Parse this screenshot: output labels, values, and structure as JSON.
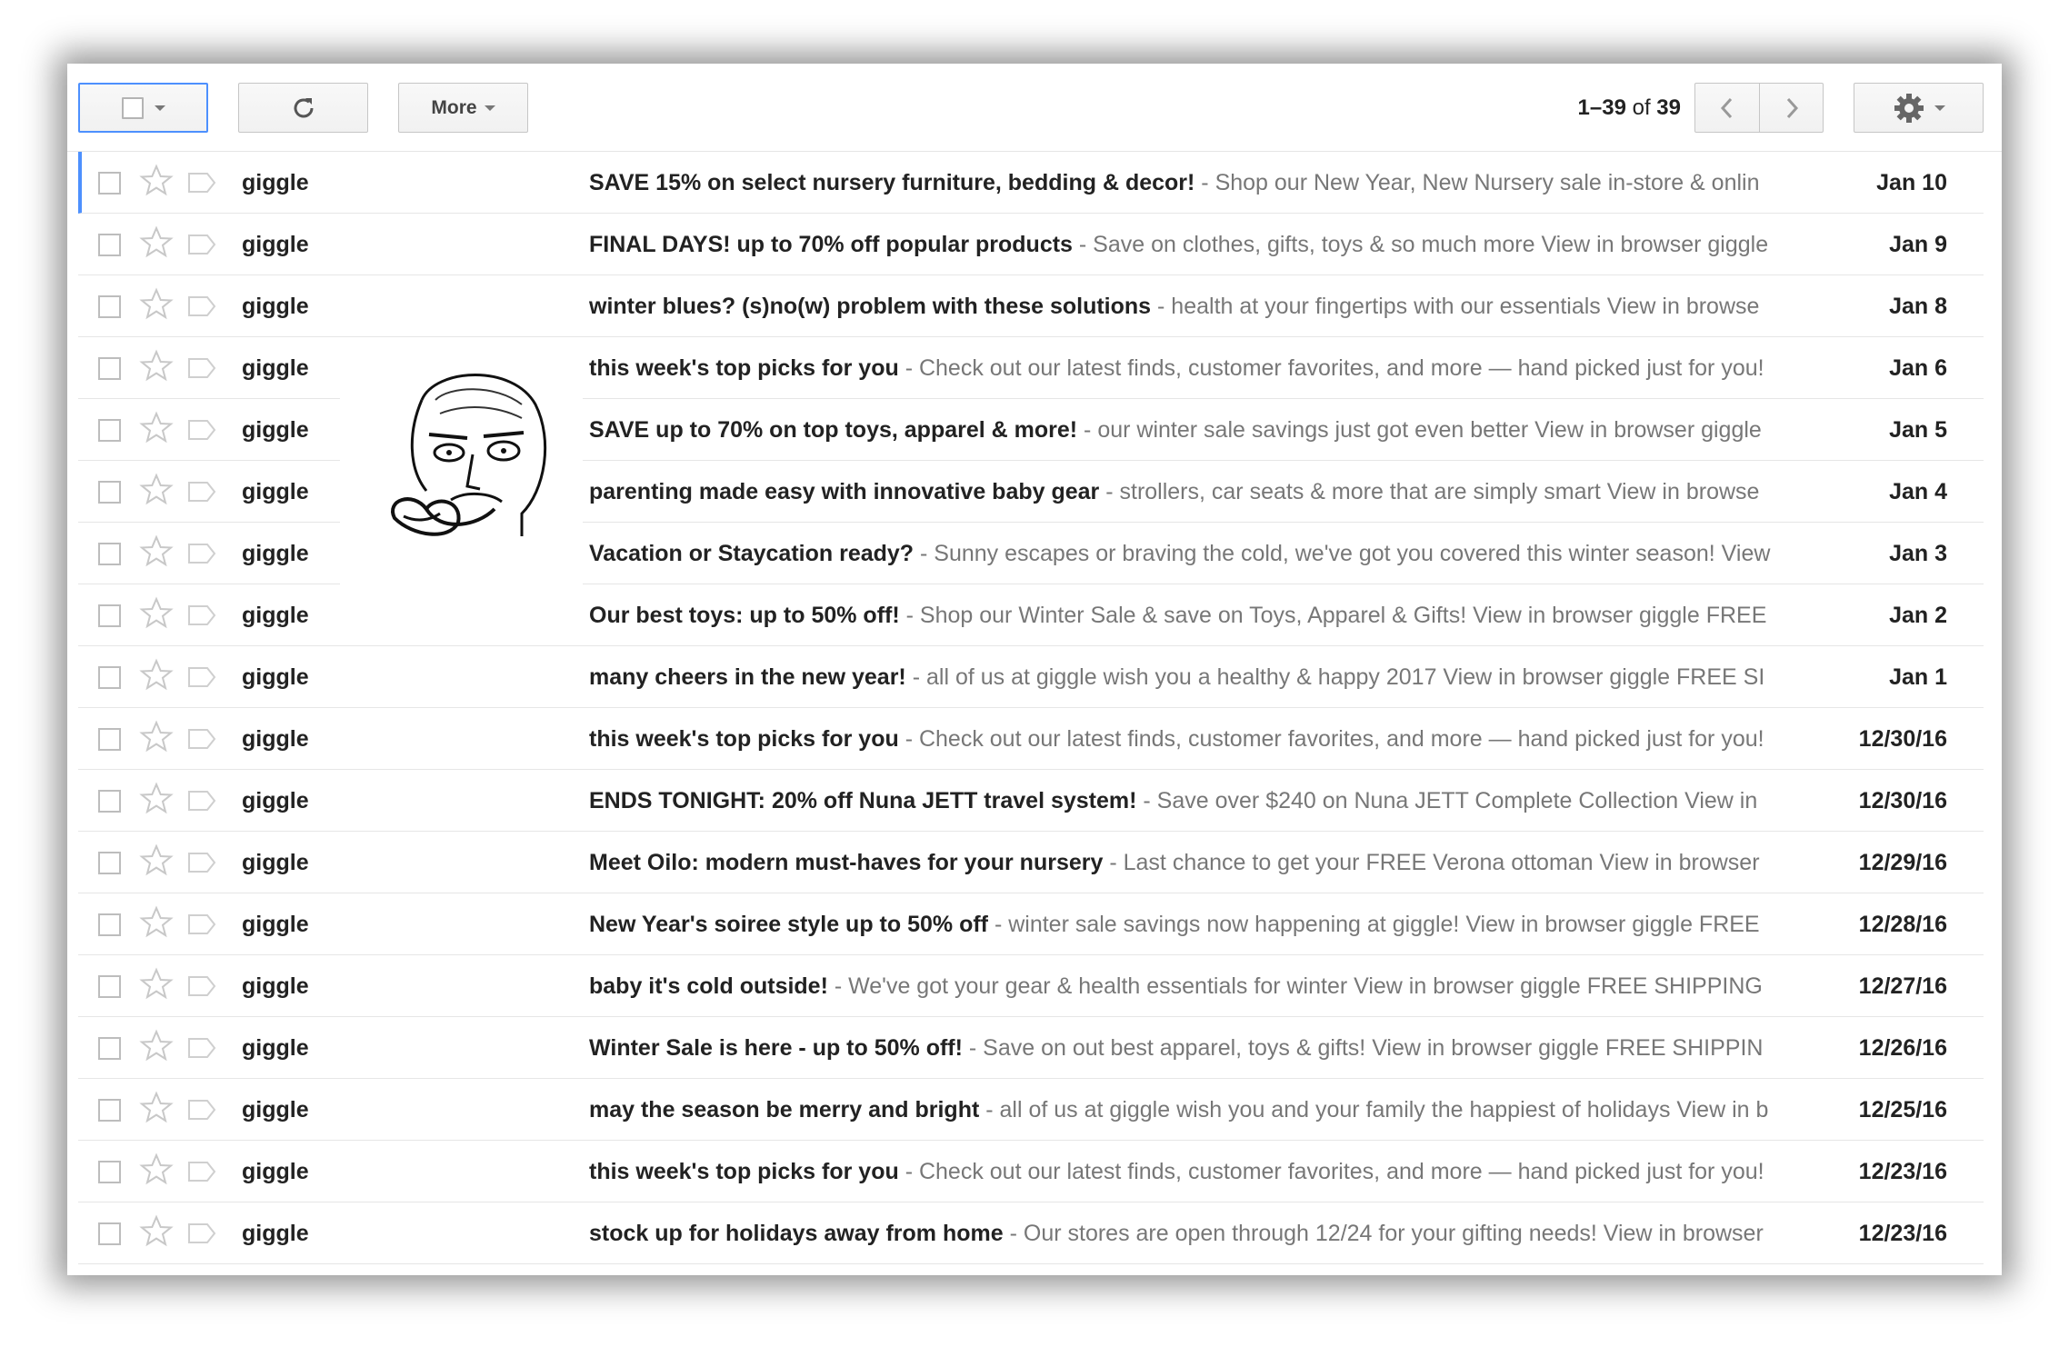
{
  "toolbar": {
    "more_label": "More",
    "pager_range": "1–39",
    "pager_of": "of",
    "pager_total": "39",
    "icons": [
      "checkbox-icon",
      "refresh-icon",
      "chevron-left-icon",
      "chevron-right-icon",
      "gear-icon"
    ]
  },
  "colors": {
    "accent": "#4d90fe",
    "snippet": "#777777",
    "text": "#222222"
  },
  "emails": [
    {
      "sender": "giggle",
      "subject": "SAVE 15% on select nursery furniture, bedding & decor!",
      "snippet": " - Shop our New Year, New Nursery sale in-store & onlin",
      "date": "Jan 10"
    },
    {
      "sender": "giggle",
      "subject": "FINAL DAYS! up to 70% off popular products",
      "snippet": " - Save on clothes, gifts, toys & so much more View in browser giggle",
      "date": "Jan 9"
    },
    {
      "sender": "giggle",
      "subject": "winter blues? (s)no(w) problem with these solutions",
      "snippet": " - health at your fingertips with our essentials View in browse",
      "date": "Jan 8"
    },
    {
      "sender": "giggle",
      "subject": "this week's top picks for you",
      "snippet": " - Check out our latest finds, customer favorites, and more — hand picked just for you!",
      "date": "Jan 6"
    },
    {
      "sender": "giggle",
      "subject": "SAVE up to 70% on top toys, apparel & more!",
      "snippet": " - our winter sale savings just got even better View in browser giggle",
      "date": "Jan 5"
    },
    {
      "sender": "giggle",
      "subject": "parenting made easy with innovative baby gear",
      "snippet": " - strollers, car seats & more that are simply smart View in browse",
      "date": "Jan 4"
    },
    {
      "sender": "giggle",
      "subject": "Vacation or Staycation ready?",
      "snippet": " - Sunny escapes or braving the cold, we've got you covered this winter season! View",
      "date": "Jan 3"
    },
    {
      "sender": "giggle",
      "subject": "Our best toys: up to 50% off!",
      "snippet": " - Shop our Winter Sale & save on Toys, Apparel & Gifts! View in browser giggle FREE",
      "date": "Jan 2"
    },
    {
      "sender": "giggle",
      "subject": "many cheers in the new year!",
      "snippet": " - all of us at giggle wish you a healthy & happy 2017 View in browser giggle FREE SI",
      "date": "Jan 1"
    },
    {
      "sender": "giggle",
      "subject": "this week's top picks for you",
      "snippet": " - Check out our latest finds, customer favorites, and more — hand picked just for you!",
      "date": "12/30/16"
    },
    {
      "sender": "giggle",
      "subject": "ENDS TONIGHT: 20% off Nuna JETT travel system!",
      "snippet": " - Save over $240 on Nuna JETT Complete Collection View in",
      "date": "12/30/16"
    },
    {
      "sender": "giggle",
      "subject": "Meet Oilo: modern must-haves for your nursery",
      "snippet": " - Last chance to get your FREE Verona ottoman View in browser",
      "date": "12/29/16"
    },
    {
      "sender": "giggle",
      "subject": "New Year's soiree style up to 50% off",
      "snippet": " - winter sale savings now happening at giggle! View in browser giggle FREE",
      "date": "12/28/16"
    },
    {
      "sender": "giggle",
      "subject": "baby it's cold outside!",
      "snippet": " - We've got your gear & health essentials for winter View in browser giggle FREE SHIPPING",
      "date": "12/27/16"
    },
    {
      "sender": "giggle",
      "subject": "Winter Sale is here - up to 50% off!",
      "snippet": " - Save on out best apparel, toys & gifts! View in browser giggle FREE SHIPPIN",
      "date": "12/26/16"
    },
    {
      "sender": "giggle",
      "subject": "may the season be merry and bright",
      "snippet": " - all of us at giggle wish you and your family the happiest of holidays View in b",
      "date": "12/25/16"
    },
    {
      "sender": "giggle",
      "subject": "this week's top picks for you",
      "snippet": " - Check out our latest finds, customer favorites, and more — hand picked just for you!",
      "date": "12/23/16"
    },
    {
      "sender": "giggle",
      "subject": "stock up for holidays away from home",
      "snippet": " - Our stores are open through 12/24 for your gifting needs! View in browser",
      "date": "12/23/16"
    }
  ]
}
